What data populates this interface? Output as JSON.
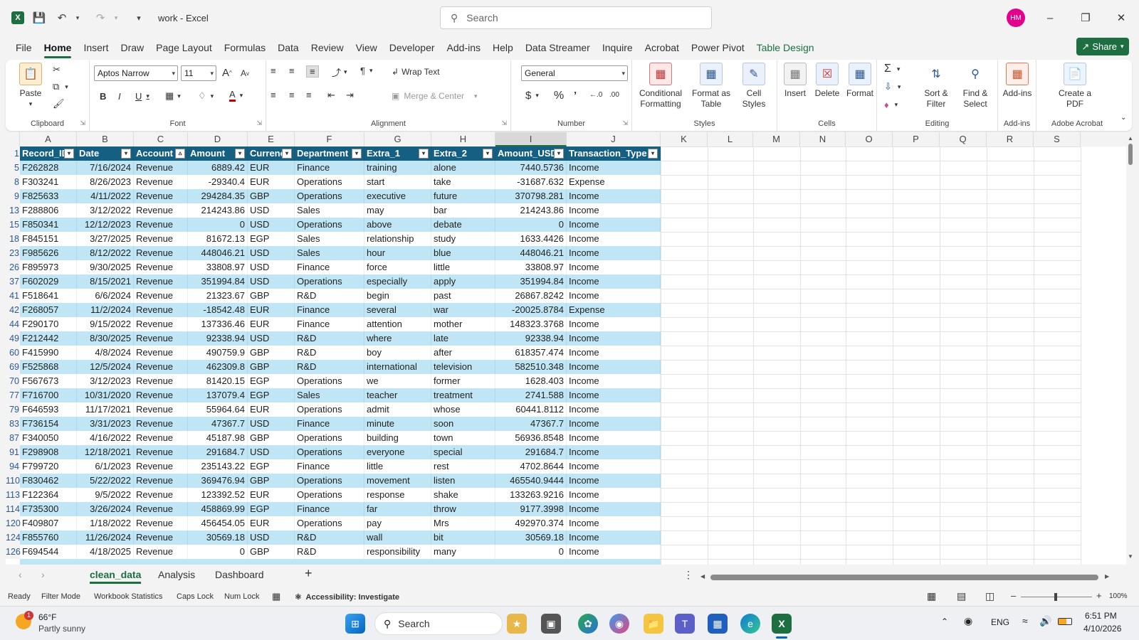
{
  "app": {
    "doc_title": "work  -  Excel",
    "search_placeholder": "Search",
    "avatar_initials": "HM",
    "share_label": "Share"
  },
  "menu": [
    "File",
    "Home",
    "Insert",
    "Draw",
    "Page Layout",
    "Formulas",
    "Data",
    "Review",
    "View",
    "Developer",
    "Add-ins",
    "Help",
    "Data Streamer",
    "Inquire",
    "Acrobat",
    "Power Pivot",
    "Table Design"
  ],
  "ribbon": {
    "clipboard": {
      "paste": "Paste",
      "label": "Clipboard"
    },
    "font": {
      "name": "Aptos Narrow",
      "size": "11",
      "label": "Font"
    },
    "alignment": {
      "wrap": "Wrap Text",
      "merge": "Merge & Center",
      "label": "Alignment"
    },
    "number": {
      "format": "General",
      "label": "Number"
    },
    "styles": {
      "conditional": "Conditional Formatting",
      "format_table": "Format as Table",
      "cell_styles": "Cell Styles",
      "label": "Styles"
    },
    "cells": {
      "insert": "Insert",
      "delete": "Delete",
      "format": "Format",
      "label": "Cells"
    },
    "editing": {
      "sort": "Sort & Filter",
      "find": "Find & Select",
      "label": "Editing"
    },
    "addins": {
      "addins": "Add-ins",
      "label": "Add-ins"
    },
    "acrobat": {
      "create": "Create a PDF",
      "label": "Adobe Acrobat"
    }
  },
  "columns": [
    "A",
    "B",
    "C",
    "D",
    "E",
    "F",
    "G",
    "H",
    "I",
    "J",
    "K",
    "L",
    "M",
    "N",
    "O",
    "P",
    "Q",
    "R",
    "S"
  ],
  "table_headers": [
    "Record_ID",
    "Date",
    "Account",
    "Amount",
    "Currency",
    "Department",
    "Extra_1",
    "Extra_2",
    "Amount_USD",
    "Transaction_Type"
  ],
  "rows": [
    {
      "n": "5",
      "c": [
        "F262828",
        "7/16/2024",
        "Revenue",
        "6889.42",
        "EUR",
        "Finance",
        "training",
        "alone",
        "7440.5736",
        "Income"
      ]
    },
    {
      "n": "8",
      "c": [
        "F303241",
        "8/26/2023",
        "Revenue",
        "-29340.4",
        "EUR",
        "Operations",
        "start",
        "take",
        "-31687.632",
        "Expense"
      ]
    },
    {
      "n": "9",
      "c": [
        "F825633",
        "4/11/2022",
        "Revenue",
        "294284.35",
        "GBP",
        "Operations",
        "executive",
        "future",
        "370798.281",
        "Income"
      ]
    },
    {
      "n": "13",
      "c": [
        "F288806",
        "3/12/2022",
        "Revenue",
        "214243.86",
        "USD",
        "Sales",
        "may",
        "bar",
        "214243.86",
        "Income"
      ]
    },
    {
      "n": "15",
      "c": [
        "F850341",
        "12/12/2023",
        "Revenue",
        "0",
        "USD",
        "Operations",
        "above",
        "debate",
        "0",
        "Income"
      ]
    },
    {
      "n": "18",
      "c": [
        "F845151",
        "3/27/2025",
        "Revenue",
        "81672.13",
        "EGP",
        "Sales",
        "relationship",
        "study",
        "1633.4426",
        "Income"
      ]
    },
    {
      "n": "23",
      "c": [
        "F985626",
        "8/12/2022",
        "Revenue",
        "448046.21",
        "USD",
        "Sales",
        "hour",
        "blue",
        "448046.21",
        "Income"
      ]
    },
    {
      "n": "26",
      "c": [
        "F895973",
        "9/30/2025",
        "Revenue",
        "33808.97",
        "USD",
        "Finance",
        "force",
        "little",
        "33808.97",
        "Income"
      ]
    },
    {
      "n": "37",
      "c": [
        "F602029",
        "8/15/2021",
        "Revenue",
        "351994.84",
        "USD",
        "Operations",
        "especially",
        "apply",
        "351994.84",
        "Income"
      ]
    },
    {
      "n": "41",
      "c": [
        "F518641",
        "6/6/2024",
        "Revenue",
        "21323.67",
        "GBP",
        "R&D",
        "begin",
        "past",
        "26867.8242",
        "Income"
      ]
    },
    {
      "n": "42",
      "c": [
        "F268057",
        "11/2/2024",
        "Revenue",
        "-18542.48",
        "EUR",
        "Finance",
        "several",
        "war",
        "-20025.8784",
        "Expense"
      ]
    },
    {
      "n": "44",
      "c": [
        "F290170",
        "9/15/2022",
        "Revenue",
        "137336.46",
        "EUR",
        "Finance",
        "attention",
        "mother",
        "148323.3768",
        "Income"
      ]
    },
    {
      "n": "49",
      "c": [
        "F212442",
        "8/30/2025",
        "Revenue",
        "92338.94",
        "USD",
        "R&D",
        "where",
        "late",
        "92338.94",
        "Income"
      ]
    },
    {
      "n": "60",
      "c": [
        "F415990",
        "4/8/2024",
        "Revenue",
        "490759.9",
        "GBP",
        "R&D",
        "boy",
        "after",
        "618357.474",
        "Income"
      ]
    },
    {
      "n": "69",
      "c": [
        "F525868",
        "12/5/2024",
        "Revenue",
        "462309.8",
        "GBP",
        "R&D",
        "international",
        "television",
        "582510.348",
        "Income"
      ]
    },
    {
      "n": "70",
      "c": [
        "F567673",
        "3/12/2023",
        "Revenue",
        "81420.15",
        "EGP",
        "Operations",
        "we",
        "former",
        "1628.403",
        "Income"
      ]
    },
    {
      "n": "77",
      "c": [
        "F716700",
        "10/31/2020",
        "Revenue",
        "137079.4",
        "EGP",
        "Sales",
        "teacher",
        "treatment",
        "2741.588",
        "Income"
      ]
    },
    {
      "n": "79",
      "c": [
        "F646593",
        "11/17/2021",
        "Revenue",
        "55964.64",
        "EUR",
        "Operations",
        "admit",
        "whose",
        "60441.8112",
        "Income"
      ]
    },
    {
      "n": "83",
      "c": [
        "F736154",
        "3/31/2023",
        "Revenue",
        "47367.7",
        "USD",
        "Finance",
        "minute",
        "soon",
        "47367.7",
        "Income"
      ]
    },
    {
      "n": "87",
      "c": [
        "F340050",
        "4/16/2022",
        "Revenue",
        "45187.98",
        "GBP",
        "Operations",
        "building",
        "town",
        "56936.8548",
        "Income"
      ]
    },
    {
      "n": "91",
      "c": [
        "F298908",
        "12/18/2021",
        "Revenue",
        "291684.7",
        "USD",
        "Operations",
        "everyone",
        "special",
        "291684.7",
        "Income"
      ]
    },
    {
      "n": "94",
      "c": [
        "F799720",
        "6/1/2023",
        "Revenue",
        "235143.22",
        "EGP",
        "Finance",
        "little",
        "rest",
        "4702.8644",
        "Income"
      ]
    },
    {
      "n": "110",
      "c": [
        "F830462",
        "5/22/2022",
        "Revenue",
        "369476.94",
        "GBP",
        "Operations",
        "movement",
        "listen",
        "465540.9444",
        "Income"
      ]
    },
    {
      "n": "113",
      "c": [
        "F122364",
        "9/5/2022",
        "Revenue",
        "123392.52",
        "EUR",
        "Operations",
        "response",
        "shake",
        "133263.9216",
        "Income"
      ]
    },
    {
      "n": "114",
      "c": [
        "F735300",
        "3/26/2024",
        "Revenue",
        "458869.99",
        "EGP",
        "Finance",
        "far",
        "throw",
        "9177.3998",
        "Income"
      ]
    },
    {
      "n": "120",
      "c": [
        "F409807",
        "1/18/2022",
        "Revenue",
        "456454.05",
        "EUR",
        "Operations",
        "pay",
        "Mrs",
        "492970.374",
        "Income"
      ]
    },
    {
      "n": "124",
      "c": [
        "F855760",
        "11/26/2024",
        "Revenue",
        "30569.18",
        "USD",
        "R&D",
        "wall",
        "bit",
        "30569.18",
        "Income"
      ]
    },
    {
      "n": "126",
      "c": [
        "F694544",
        "4/18/2025",
        "Revenue",
        "0",
        "GBP",
        "R&D",
        "responsibility",
        "many",
        "0",
        "Income"
      ]
    }
  ],
  "sheets": [
    "clean_data",
    "Analysis",
    "Dashboard"
  ],
  "status": {
    "ready": "Ready",
    "filter": "Filter Mode",
    "stats": "Workbook Statistics",
    "caps": "Caps Lock",
    "num": "Num Lock",
    "accessibility": "Accessibility: Investigate",
    "zoom": "100%"
  },
  "taskbar": {
    "temp": "66°F",
    "weather": "Partly sunny",
    "weather_badge": "1",
    "search": "Search",
    "lang": "ENG",
    "time": "6:51 PM",
    "date": "4/10/2026"
  },
  "colors": {
    "excel_green": "#1d6f42",
    "table_header": "#156082",
    "band": "#c0e6f5",
    "avatar": "#e3008c"
  }
}
